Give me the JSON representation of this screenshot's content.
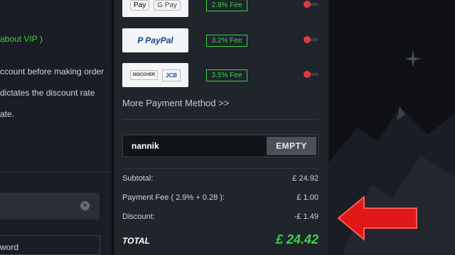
{
  "left": {
    "vip_text_green": "about VIP",
    "vip_text_close": ")",
    "notes": [
      "ccount before making order",
      "dictates the discount rate",
      "ate."
    ],
    "field_label": "word"
  },
  "payments": [
    {
      "logos": [
        "Pay",
        "G Pay"
      ],
      "fee": "2.9% Fee",
      "enabled": true
    },
    {
      "logos": [
        "PayPal"
      ],
      "fee": "3.2% Fee",
      "enabled": true
    },
    {
      "logos": [
        "DISCOVER",
        "JCB"
      ],
      "fee": "3.5% Fee",
      "enabled": true
    }
  ],
  "more_methods": "More Payment Method >>",
  "coupon": {
    "value": "nannik",
    "button": "EMPTY"
  },
  "summary": {
    "subtotal_label": "Subtotal:",
    "subtotal_value": "£ 24.92",
    "fee_label": "Payment Fee ( 2.9% + 0.28 ):",
    "fee_value": "£ 1.00",
    "discount_label": "Discount:",
    "discount_value": "-£ 1.49",
    "total_label": "TOTAL",
    "total_value": "£ 24.42"
  },
  "colors": {
    "accent_green": "#3bd04a",
    "toggle_red": "#e23a3a",
    "arrow_red": "#e01818"
  }
}
